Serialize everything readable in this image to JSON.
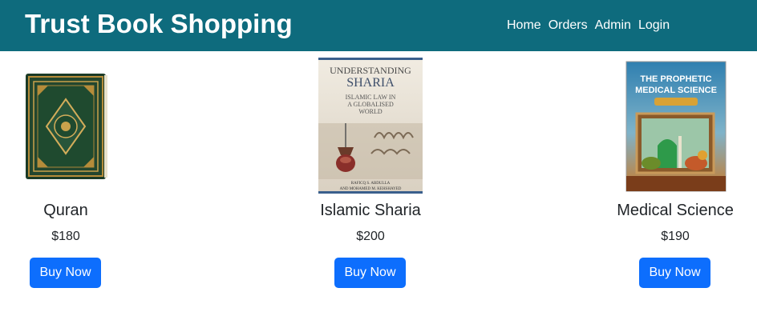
{
  "header": {
    "brand": "Trust Book Shopping",
    "nav": [
      "Home",
      "Orders",
      "Admin",
      "Login"
    ],
    "bg_color": "#0e6b7d"
  },
  "products": [
    {
      "title": "Quran",
      "price": "$180",
      "button": "Buy Now",
      "cover": {
        "lines": []
      }
    },
    {
      "title": "Islamic Sharia",
      "price": "$200",
      "button": "Buy Now",
      "cover": {
        "heading1": "UNDERSTANDING",
        "heading2": "SHARIA",
        "subtitle1": "ISLAMIC LAW IN",
        "subtitle2": "A GLOBALISED",
        "subtitle3": "WORLD",
        "authors1": "RAFICQ S. ABDULLA",
        "authors2": "AND MOHAMED M. KEHSHAYED"
      }
    },
    {
      "title": "Medical Science",
      "price": "$190",
      "button": "Buy Now",
      "cover": {
        "heading1": "THE PROPHETIC",
        "heading2": "MEDICAL SCIENCE"
      }
    }
  ],
  "colors": {
    "button": "#0d6efd",
    "text": "#212529"
  }
}
